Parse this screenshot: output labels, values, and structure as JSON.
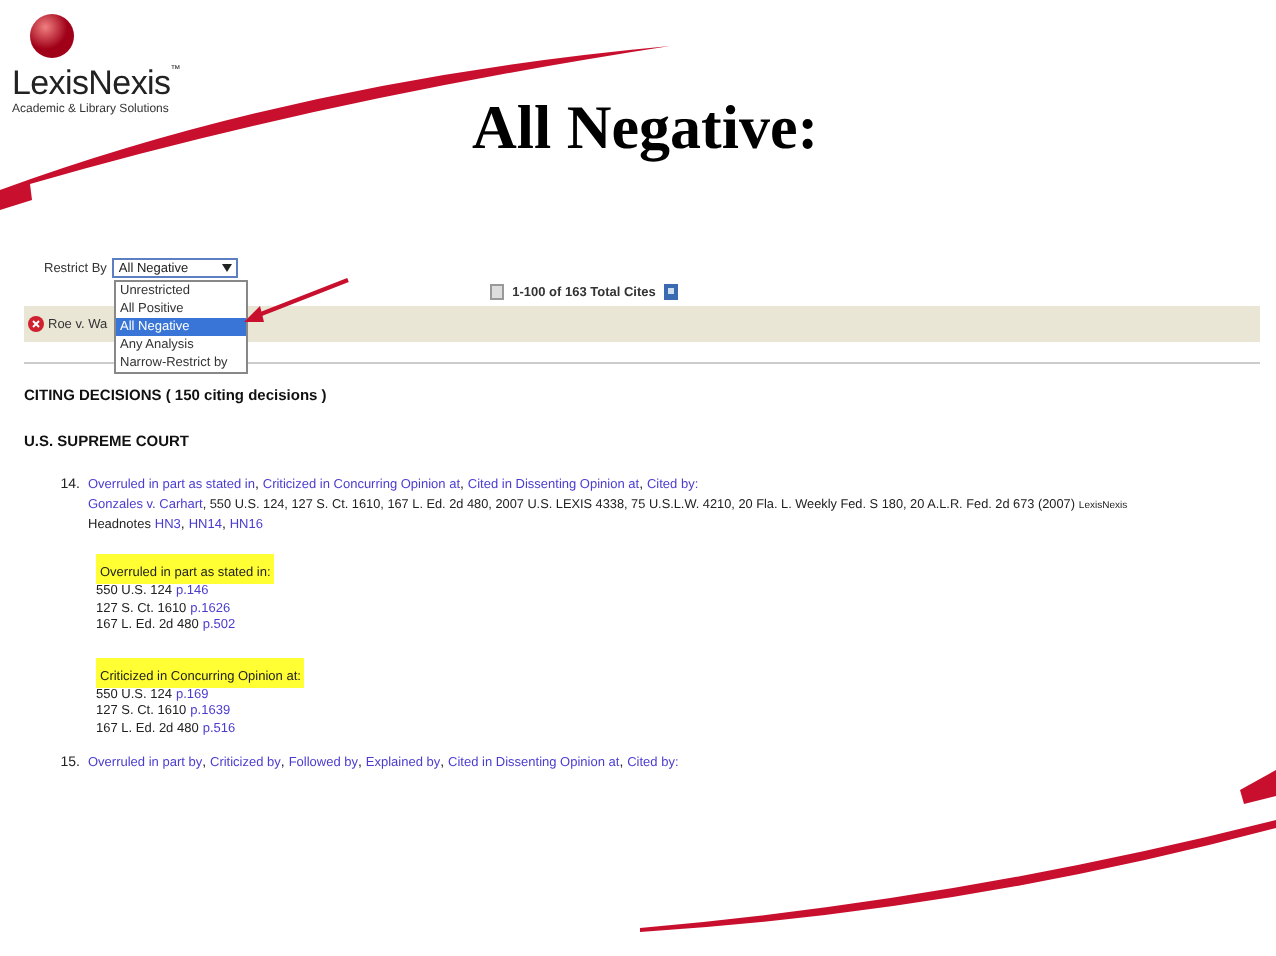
{
  "logo": {
    "name": "LexisNexis",
    "trademark": "™",
    "tagline": "Academic & Library Solutions"
  },
  "title": "All Negative:",
  "restrict": {
    "label": "Restrict By",
    "value": "All Negative",
    "expanded": true,
    "options": [
      {
        "label": "Unrestricted",
        "selected": false
      },
      {
        "label": "All Positive",
        "selected": false
      },
      {
        "label": "All Negative",
        "selected": true
      },
      {
        "label": "Any Analysis",
        "selected": false
      },
      {
        "label": "Narrow-Restrict by",
        "selected": false
      }
    ]
  },
  "pager": {
    "text": "1-100 of 163 Total Cites"
  },
  "case_bar": {
    "text": "Roe v. Wa"
  },
  "heading": "CITING DECISIONS ( 150 citing decisions )",
  "court": "U.S. SUPREME COURT",
  "separator": ",",
  "decisions": [
    {
      "number": "14.",
      "treatments": [
        "Overruled in part as stated in",
        "Criticized in Concurring Opinion at",
        "Cited in Dissenting Opinion at",
        "Cited by:"
      ],
      "case": "Gonzales v. Carhart",
      "citation": ", 550 U.S. 124, 127 S. Ct. 1610, 167 L. Ed. 2d 480, 2007 U.S. LEXIS 4338, 75 U.S.L.W. 4210, 20 Fla. L. Weekly Fed. S 180, 20 A.L.R. Fed. 2d 673 (2007)",
      "source": "LexisNexis",
      "headnotes_label": "Headnotes",
      "headnotes": [
        "HN3",
        "HN14",
        "HN16"
      ],
      "details": [
        {
          "heading": "Overruled in part as stated in:",
          "cites": [
            {
              "text": "550 U.S. 124",
              "page": "p.146"
            },
            {
              "text": "127 S. Ct. 1610",
              "page": "p.1626"
            },
            {
              "text": "167 L. Ed. 2d 480",
              "page": "p.502"
            }
          ]
        },
        {
          "heading": "Criticized in Concurring Opinion at:",
          "cites": [
            {
              "text": "550 U.S. 124",
              "page": "p.169"
            },
            {
              "text": "127 S. Ct. 1610",
              "page": "p.1639"
            },
            {
              "text": "167 L. Ed. 2d 480",
              "page": "p.516"
            }
          ]
        }
      ]
    },
    {
      "number": "15.",
      "treatments": [
        "Overruled in part by",
        "Criticized by",
        "Followed by",
        "Explained by",
        "Cited in Dissenting Opinion at",
        "Cited by:"
      ]
    }
  ]
}
